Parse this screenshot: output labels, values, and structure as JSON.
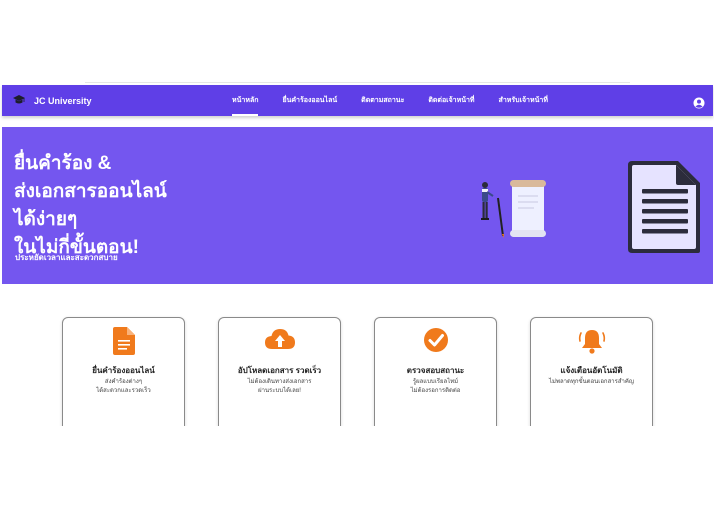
{
  "colors": {
    "primary": "#5f3fe7",
    "hero_bg": "#7456ef",
    "accent": "#f07a1c"
  },
  "navbar": {
    "brand": "JC University",
    "brand_icon": "graduation-cap-icon",
    "items": [
      {
        "label": "หน้าหลัก",
        "active": true
      },
      {
        "label": "ยื่นคำร้องออนไลน์",
        "active": false
      },
      {
        "label": "ติดตามสถานะ",
        "active": false
      },
      {
        "label": "ติดต่อเจ้าหน้าที่",
        "active": false
      },
      {
        "label": "สำหรับเจ้าหน้าที่",
        "active": false
      }
    ],
    "profile_icon": "user-circle-icon"
  },
  "hero": {
    "title": "ยื่นคำร้อง &\nส่งเอกสารออนไลน์\nได้ง่ายๆ\nในไม่กี่ขั้นตอน!",
    "subtitle": "ประหยัดเวลาและสะดวกสบาย"
  },
  "features": [
    {
      "icon": "document-icon",
      "title": "ยื่นคำร้องออนไลน์",
      "desc": "ส่งคำร้องต่างๆ\nได้สะดวกและรวดเร็ว"
    },
    {
      "icon": "cloud-upload-icon",
      "title": "อัปโหลดเอกสาร รวดเร็ว",
      "desc": "ไม่ต้องเดินทางส่งเอกสาร\nผ่านระบบได้เลย!"
    },
    {
      "icon": "check-circle-icon",
      "title": "ตรวจสอบสถานะ",
      "desc": "รู้ผลแบบเรียลไทม์\nไม่ต้องรอการติดต่อ"
    },
    {
      "icon": "bell-icon",
      "title": "แจ้งเตือนอัตโนมัติ",
      "desc": "ไม่พลาดทุกขั้นตอนเอกสารสำคัญ"
    }
  ]
}
